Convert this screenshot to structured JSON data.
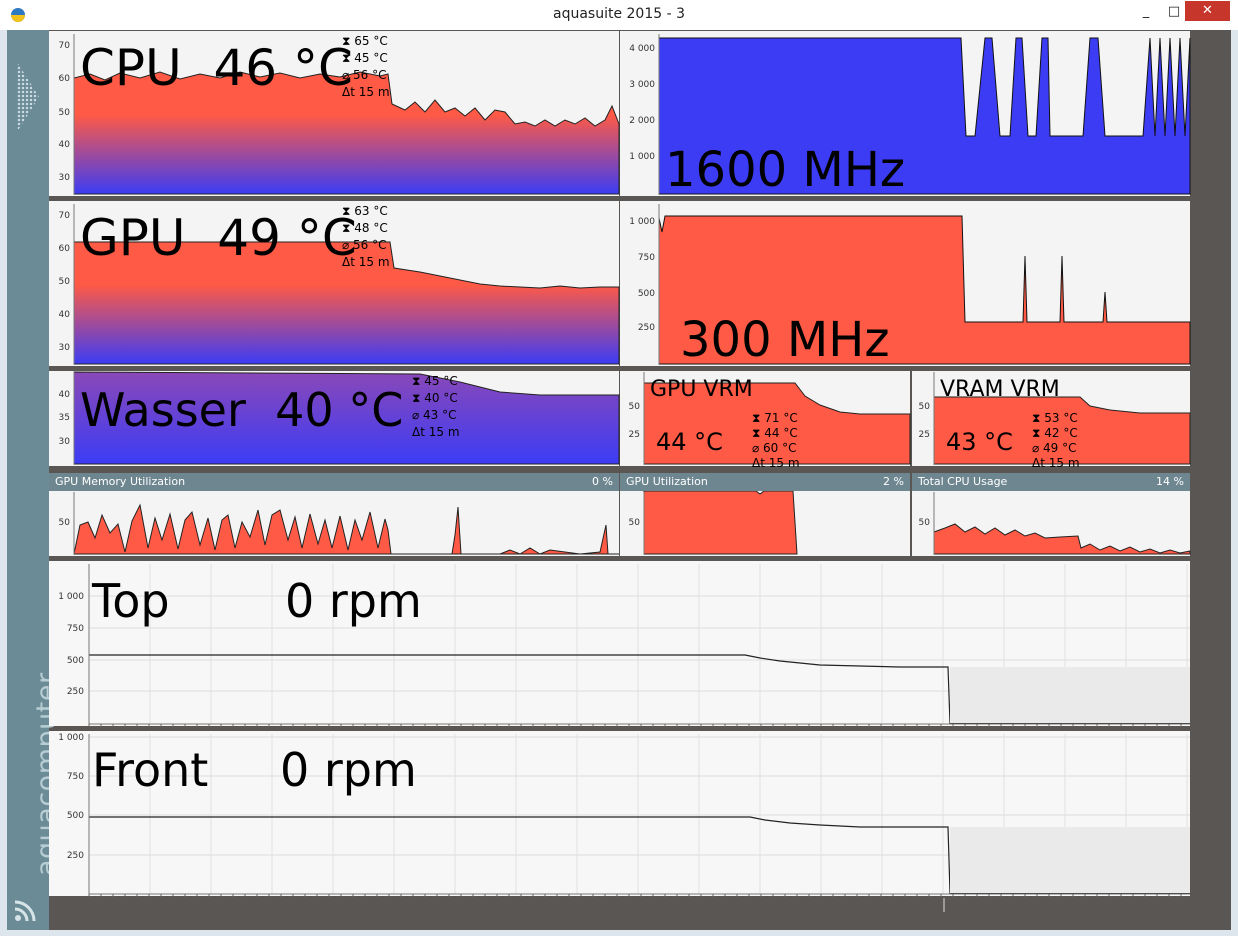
{
  "window": {
    "title": "aquasuite 2015 - 3",
    "minimize": "_",
    "maximize": "□",
    "close": "✕",
    "icon": "aquasuite-app-icon"
  },
  "sidebar": {
    "brand": "aquacomputer",
    "icons": [
      "dots-arrow-icon",
      "rss-icon"
    ]
  },
  "colors": {
    "temp_top": "#ff5a45",
    "temp_bottom": "#3c3cf5",
    "fill_red": "#ff5a45",
    "fill_blue": "#3c3cf5",
    "panel_bg": "#f4f4f4",
    "header": "#6d8690"
  },
  "panels": {
    "cpu_temp": {
      "label": "CPU",
      "value": "46 °C",
      "max": "65 °C",
      "min": "45 °C",
      "avg": "56 °C",
      "span": "15 m",
      "yticks": [
        "70",
        "60",
        "50",
        "40",
        "30"
      ]
    },
    "cpu_clock": {
      "value": "1600 MHz",
      "yticks": [
        "4 000",
        "3 000",
        "2 000",
        "1 000"
      ]
    },
    "gpu_temp": {
      "label": "GPU",
      "value": "49 °C",
      "max": "63 °C",
      "min": "48 °C",
      "avg": "56 °C",
      "span": "15 m",
      "yticks": [
        "70",
        "60",
        "50",
        "40",
        "30"
      ]
    },
    "gpu_clock": {
      "value": "300 MHz",
      "yticks": [
        "1 000",
        "750",
        "500",
        "250"
      ]
    },
    "water_temp": {
      "label": "Wasser",
      "value": "40 °C",
      "max": "45 °C",
      "min": "40 °C",
      "avg": "43 °C",
      "span": "15 m",
      "yticks": [
        "40",
        "35",
        "30"
      ]
    },
    "gpu_vrm": {
      "label": "GPU VRM",
      "value": "44 °C",
      "max": "71 °C",
      "min": "44 °C",
      "avg": "60 °C",
      "span": "15 m",
      "yticks": [
        "50",
        "25"
      ]
    },
    "vram_vrm": {
      "label": "VRAM VRM",
      "value": "43 °C",
      "max": "53 °C",
      "min": "42 °C",
      "avg": "49 °C",
      "span": "15 m",
      "yticks": [
        "50",
        "25"
      ]
    },
    "gpu_mem_util": {
      "label": "GPU Memory Utilization",
      "value": "0 %",
      "yticks": [
        "50"
      ]
    },
    "gpu_util": {
      "label": "GPU Utilization",
      "value": "2 %",
      "yticks": [
        "50"
      ]
    },
    "cpu_usage": {
      "label": "Total CPU Usage",
      "value": "14 %",
      "yticks": [
        "50"
      ]
    },
    "fan_top": {
      "label": "Top",
      "value": "0 rpm",
      "yticks": [
        "1 000",
        "750",
        "500",
        "250"
      ]
    },
    "fan_front": {
      "label": "Front",
      "value": "0 rpm",
      "yticks": [
        "1 000",
        "750",
        "500",
        "250"
      ]
    }
  }
}
